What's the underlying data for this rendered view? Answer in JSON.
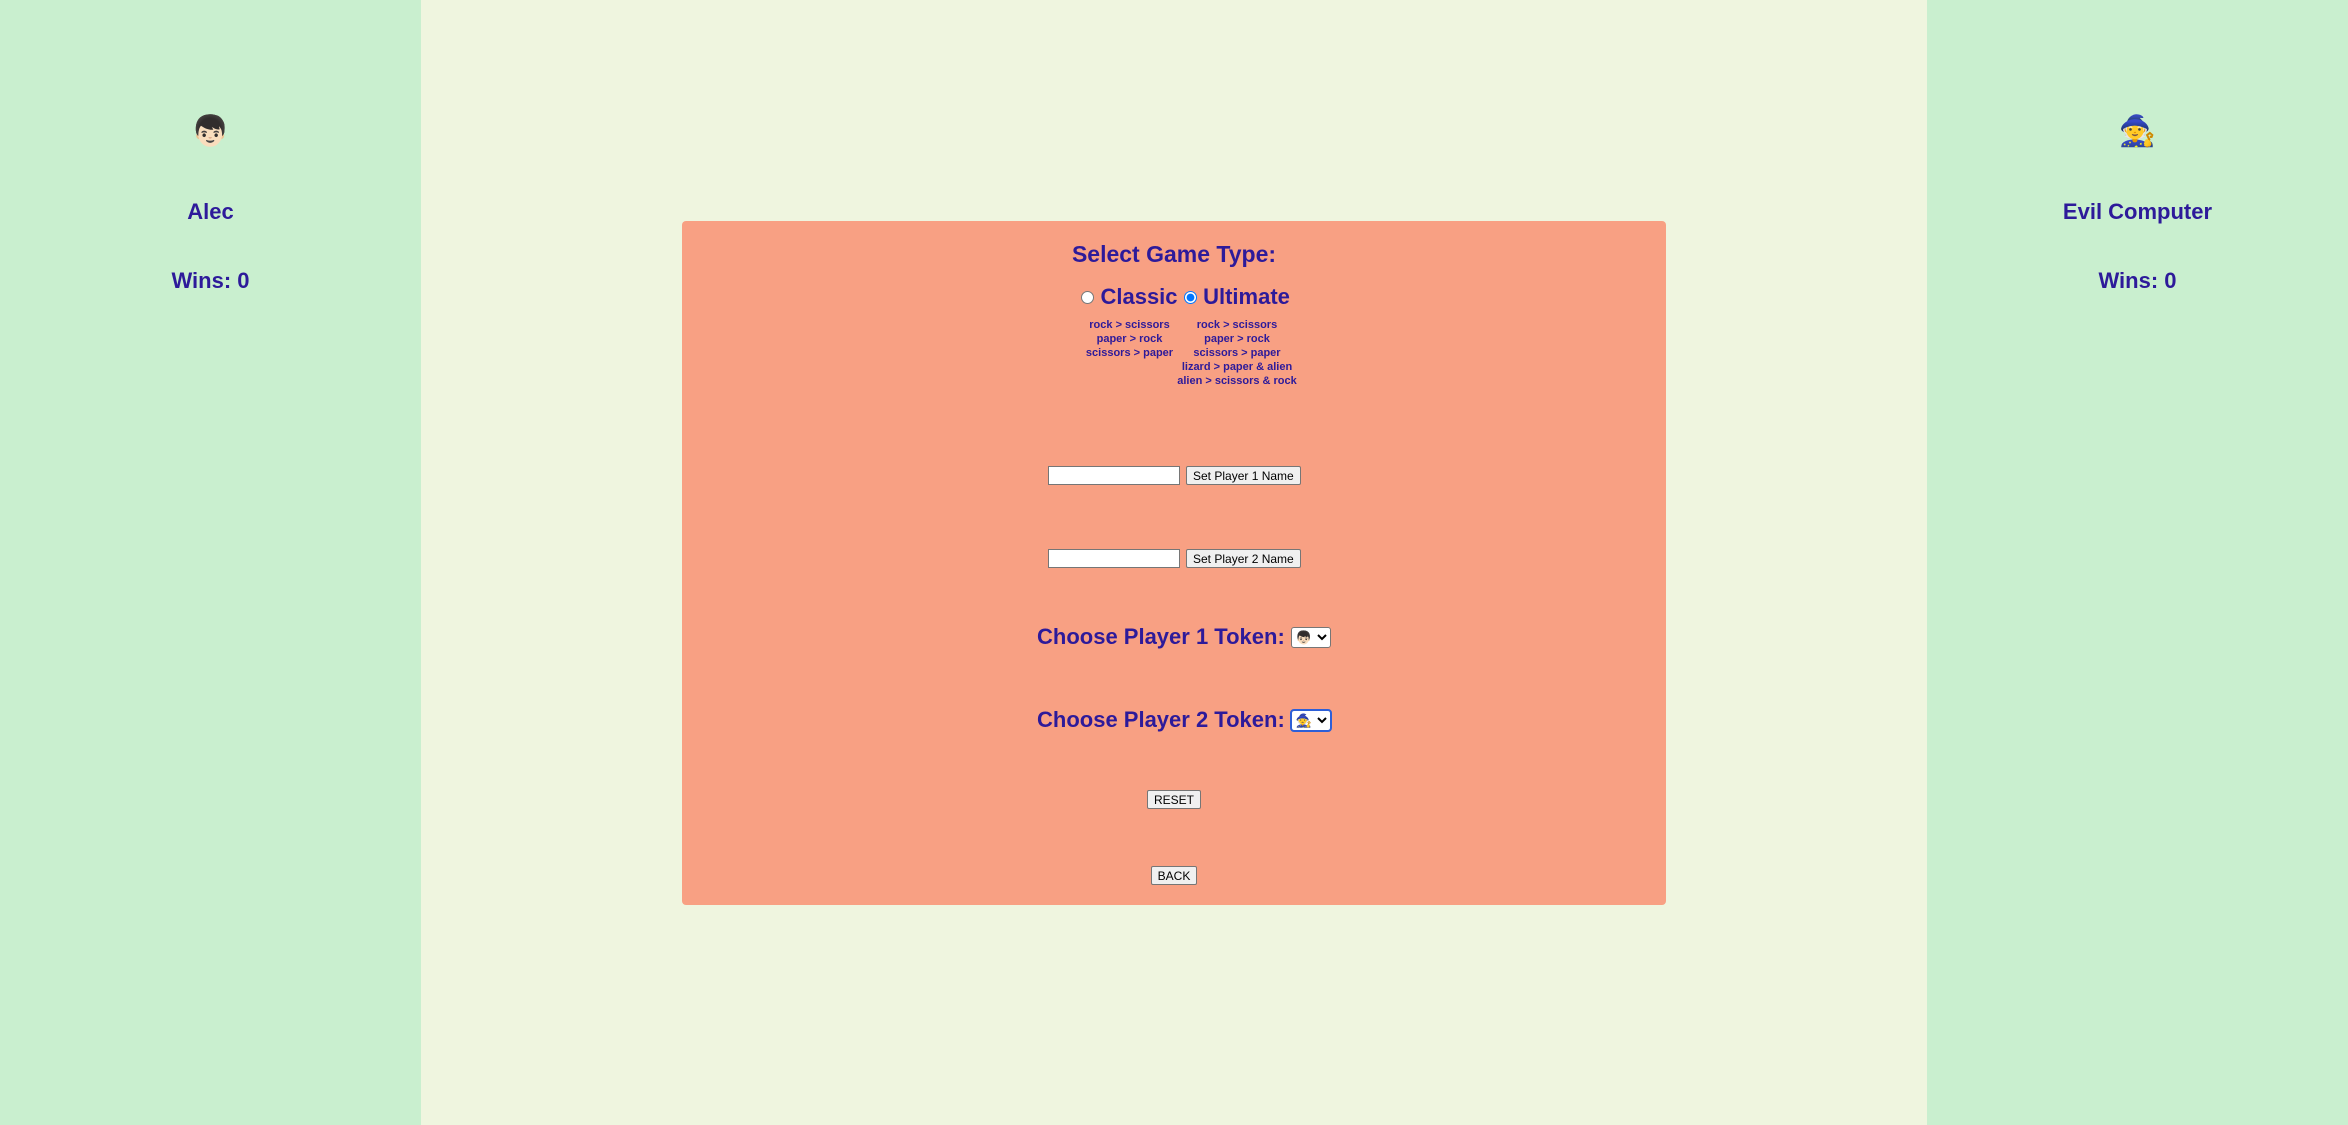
{
  "player1": {
    "token": "👦🏻",
    "name": "Alec",
    "wins_label": "Wins:",
    "wins": "0"
  },
  "player2": {
    "token": "🧙",
    "name": "Evil Computer",
    "wins_label": "Wins:",
    "wins": "0"
  },
  "settings": {
    "title": "Select Game Type:",
    "classic": {
      "label": "Classic",
      "selected": false,
      "rules": [
        "rock > scissors",
        "paper > rock",
        "scissors > paper"
      ]
    },
    "ultimate": {
      "label": "Ultimate",
      "selected": true,
      "rules": [
        "rock > scissors",
        "paper > rock",
        "scissors > paper",
        "lizard > paper & alien",
        "alien > scissors & rock"
      ]
    },
    "player1_name_input": {
      "value": "",
      "button": "Set Player 1 Name"
    },
    "player2_name_input": {
      "value": "",
      "button": "Set Player 2 Name"
    },
    "player1_token": {
      "label": "Choose Player 1 Token:",
      "selected": "👦🏻"
    },
    "player2_token": {
      "label": "Choose Player 2 Token:",
      "selected": "🧙"
    },
    "reset_label": "RESET",
    "back_label": "BACK"
  },
  "colors": {
    "side_bg": "#c9efcf",
    "page_bg": "#eff5df",
    "panel_bg": "#f8a083",
    "text": "#2d1a9a"
  }
}
